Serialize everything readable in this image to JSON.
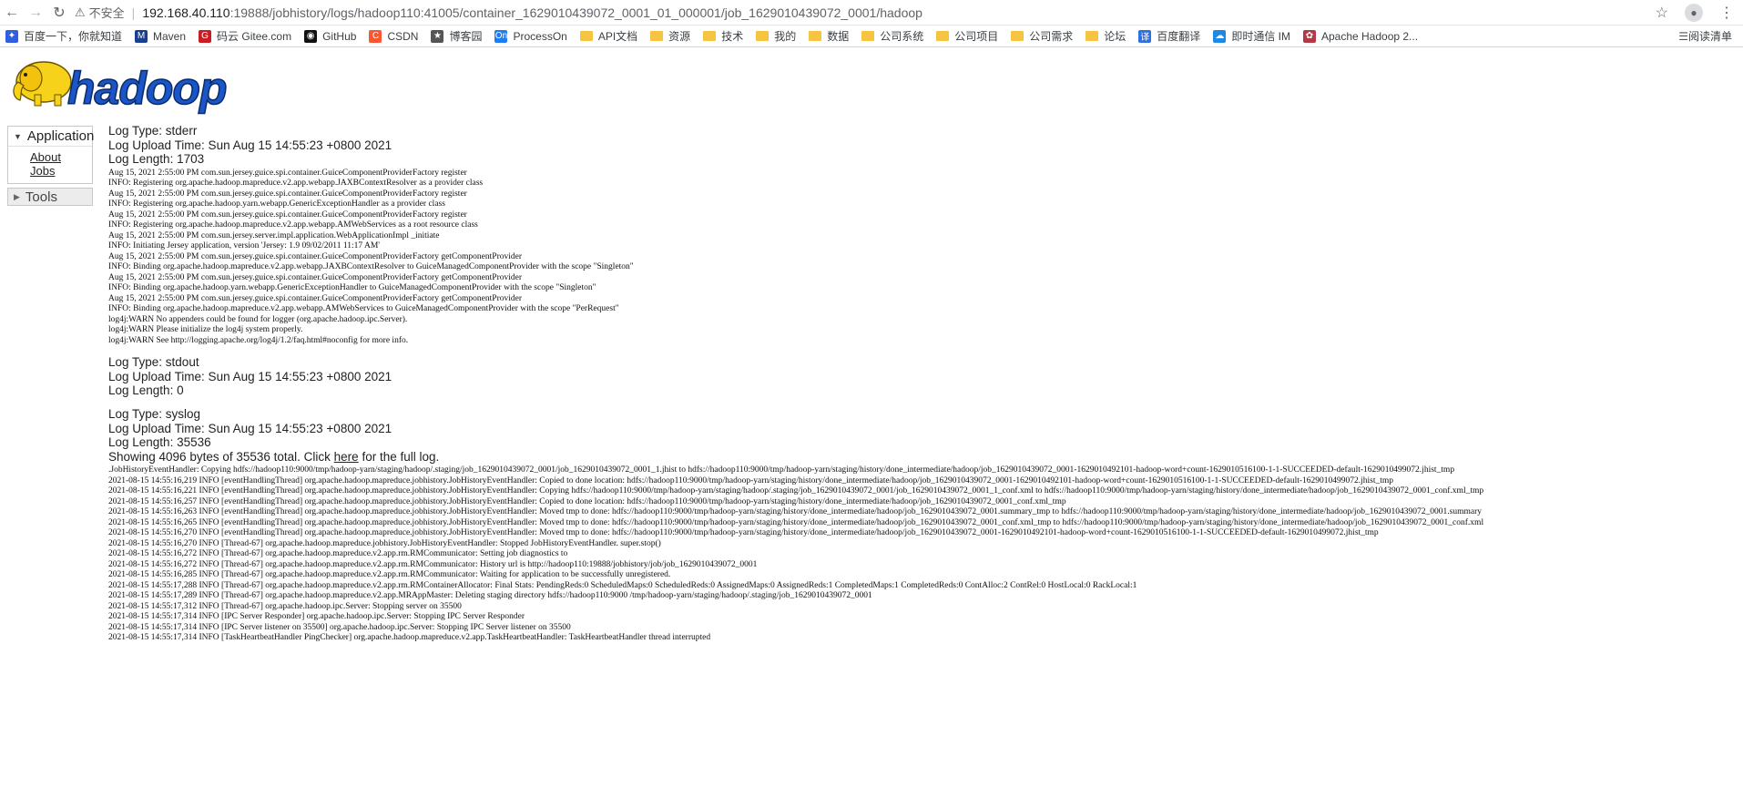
{
  "browser": {
    "insecure_label": "不安全",
    "url_host": "192.168.40.110",
    "url_path": ":19888/jobhistory/logs/hadoop110:41005/container_1629010439072_0001_01_000001/job_1629010439072_0001/hadoop"
  },
  "bookmarks": [
    {
      "label": "百度一下，你就知道",
      "icon": "paw-icon",
      "color": "#2f5fe0"
    },
    {
      "label": "Maven",
      "icon": "maven-icon",
      "color": "#1a3f8f"
    },
    {
      "label": "码云 Gitee.com",
      "icon": "gitee-icon",
      "color": "#c71d23"
    },
    {
      "label": "GitHub",
      "icon": "github-icon",
      "color": "#111111"
    },
    {
      "label": "CSDN",
      "icon": "csdn-icon",
      "color": "#fc5531"
    },
    {
      "label": "博客园",
      "icon": "cnblogs-icon",
      "color": "#555555"
    },
    {
      "label": "ProcessOn",
      "icon": "processon-icon",
      "color": "#1f7cf1"
    },
    {
      "label": "API文档",
      "icon": "folder-icon",
      "color": "#f5c542"
    },
    {
      "label": "资源",
      "icon": "folder-icon",
      "color": "#f5c542"
    },
    {
      "label": "技术",
      "icon": "folder-icon",
      "color": "#f5c542"
    },
    {
      "label": "我的",
      "icon": "folder-icon",
      "color": "#f5c542"
    },
    {
      "label": "数据",
      "icon": "folder-icon",
      "color": "#f5c542"
    },
    {
      "label": "公司系统",
      "icon": "folder-icon",
      "color": "#f5c542"
    },
    {
      "label": "公司项目",
      "icon": "folder-icon",
      "color": "#f5c542"
    },
    {
      "label": "公司需求",
      "icon": "folder-icon",
      "color": "#f5c542"
    },
    {
      "label": "论坛",
      "icon": "folder-icon",
      "color": "#f5c542"
    },
    {
      "label": "百度翻译",
      "icon": "translate-icon",
      "color": "#2f6fe0"
    },
    {
      "label": "即时通信 IM",
      "icon": "cloud-icon",
      "color": "#1e88e5"
    },
    {
      "label": "Apache Hadoop 2...",
      "icon": "feather-icon",
      "color": "#b23a48"
    }
  ],
  "reading_list": "阅读清单",
  "logo": {
    "text": "hadoop"
  },
  "nav": {
    "application": "Application",
    "links": [
      "About",
      "Jobs"
    ],
    "tools": "Tools"
  },
  "stderr": {
    "type": "Log Type: stderr",
    "upload": "Log Upload Time: Sun Aug 15 14:55:23 +0800 2021",
    "length": "Log Length: 1703",
    "lines": "Aug 15, 2021 2:55:00 PM com.sun.jersey.guice.spi.container.GuiceComponentProviderFactory register\nINFO: Registering org.apache.hadoop.mapreduce.v2.app.webapp.JAXBContextResolver as a provider class\nAug 15, 2021 2:55:00 PM com.sun.jersey.guice.spi.container.GuiceComponentProviderFactory register\nINFO: Registering org.apache.hadoop.yarn.webapp.GenericExceptionHandler as a provider class\nAug 15, 2021 2:55:00 PM com.sun.jersey.guice.spi.container.GuiceComponentProviderFactory register\nINFO: Registering org.apache.hadoop.mapreduce.v2.app.webapp.AMWebServices as a root resource class\nAug 15, 2021 2:55:00 PM com.sun.jersey.server.impl.application.WebApplicationImpl _initiate\nINFO: Initiating Jersey application, version 'Jersey: 1.9 09/02/2011 11:17 AM'\nAug 15, 2021 2:55:00 PM com.sun.jersey.guice.spi.container.GuiceComponentProviderFactory getComponentProvider\nINFO: Binding org.apache.hadoop.mapreduce.v2.app.webapp.JAXBContextResolver to GuiceManagedComponentProvider with the scope \"Singleton\"\nAug 15, 2021 2:55:00 PM com.sun.jersey.guice.spi.container.GuiceComponentProviderFactory getComponentProvider\nINFO: Binding org.apache.hadoop.yarn.webapp.GenericExceptionHandler to GuiceManagedComponentProvider with the scope \"Singleton\"\nAug 15, 2021 2:55:00 PM com.sun.jersey.guice.spi.container.GuiceComponentProviderFactory getComponentProvider\nINFO: Binding org.apache.hadoop.mapreduce.v2.app.webapp.AMWebServices to GuiceManagedComponentProvider with the scope \"PerRequest\"\nlog4j:WARN No appenders could be found for logger (org.apache.hadoop.ipc.Server).\nlog4j:WARN Please initialize the log4j system properly.\nlog4j:WARN See http://logging.apache.org/log4j/1.2/faq.html#noconfig for more info."
  },
  "stdout": {
    "type": "Log Type: stdout",
    "upload": "Log Upload Time: Sun Aug 15 14:55:23 +0800 2021",
    "length": "Log Length: 0"
  },
  "syslog": {
    "type": "Log Type: syslog",
    "upload": "Log Upload Time: Sun Aug 15 14:55:23 +0800 2021",
    "length": "Log Length: 35536",
    "showing_prefix": "Showing 4096 bytes of 35536 total. Click ",
    "here": "here",
    "showing_suffix": " for the full log.",
    "lines": ".JobHistoryEventHandler: Copying hdfs://hadoop110:9000/tmp/hadoop-yarn/staging/hadoop/.staging/job_1629010439072_0001/job_1629010439072_0001_1.jhist to hdfs://hadoop110:9000/tmp/hadoop-yarn/staging/history/done_intermediate/hadoop/job_1629010439072_0001-1629010492101-hadoop-word+count-1629010516100-1-1-SUCCEEDED-default-1629010499072.jhist_tmp\n2021-08-15 14:55:16,219 INFO [eventHandlingThread] org.apache.hadoop.mapreduce.jobhistory.JobHistoryEventHandler: Copied to done location: hdfs://hadoop110:9000/tmp/hadoop-yarn/staging/history/done_intermediate/hadoop/job_1629010439072_0001-1629010492101-hadoop-word+count-1629010516100-1-1-SUCCEEDED-default-1629010499072.jhist_tmp\n2021-08-15 14:55:16,221 INFO [eventHandlingThread] org.apache.hadoop.mapreduce.jobhistory.JobHistoryEventHandler: Copying hdfs://hadoop110:9000/tmp/hadoop-yarn/staging/hadoop/.staging/job_1629010439072_0001/job_1629010439072_0001_1_conf.xml to hdfs://hadoop110:9000/tmp/hadoop-yarn/staging/history/done_intermediate/hadoop/job_1629010439072_0001_conf.xml_tmp\n2021-08-15 14:55:16,257 INFO [eventHandlingThread] org.apache.hadoop.mapreduce.jobhistory.JobHistoryEventHandler: Copied to done location: hdfs://hadoop110:9000/tmp/hadoop-yarn/staging/history/done_intermediate/hadoop/job_1629010439072_0001_conf.xml_tmp\n2021-08-15 14:55:16,263 INFO [eventHandlingThread] org.apache.hadoop.mapreduce.jobhistory.JobHistoryEventHandler: Moved tmp to done: hdfs://hadoop110:9000/tmp/hadoop-yarn/staging/history/done_intermediate/hadoop/job_1629010439072_0001.summary_tmp to hdfs://hadoop110:9000/tmp/hadoop-yarn/staging/history/done_intermediate/hadoop/job_1629010439072_0001.summary\n2021-08-15 14:55:16,265 INFO [eventHandlingThread] org.apache.hadoop.mapreduce.jobhistory.JobHistoryEventHandler: Moved tmp to done: hdfs://hadoop110:9000/tmp/hadoop-yarn/staging/history/done_intermediate/hadoop/job_1629010439072_0001_conf.xml_tmp to hdfs://hadoop110:9000/tmp/hadoop-yarn/staging/history/done_intermediate/hadoop/job_1629010439072_0001_conf.xml\n2021-08-15 14:55:16,270 INFO [eventHandlingThread] org.apache.hadoop.mapreduce.jobhistory.JobHistoryEventHandler: Moved tmp to done: hdfs://hadoop110:9000/tmp/hadoop-yarn/staging/history/done_intermediate/hadoop/job_1629010439072_0001-1629010492101-hadoop-word+count-1629010516100-1-1-SUCCEEDED-default-1629010499072.jhist_tmp\n2021-08-15 14:55:16,270 INFO [Thread-67] org.apache.hadoop.mapreduce.jobhistory.JobHistoryEventHandler: Stopped JobHistoryEventHandler. super.stop()\n2021-08-15 14:55:16,272 INFO [Thread-67] org.apache.hadoop.mapreduce.v2.app.rm.RMCommunicator: Setting job diagnostics to\n2021-08-15 14:55:16,272 INFO [Thread-67] org.apache.hadoop.mapreduce.v2.app.rm.RMCommunicator: History url is http://hadoop110:19888/jobhistory/job/job_1629010439072_0001\n2021-08-15 14:55:16,285 INFO [Thread-67] org.apache.hadoop.mapreduce.v2.app.rm.RMCommunicator: Waiting for application to be successfully unregistered.\n2021-08-15 14:55:17,288 INFO [Thread-67] org.apache.hadoop.mapreduce.v2.app.rm.RMContainerAllocator: Final Stats: PendingReds:0 ScheduledMaps:0 ScheduledReds:0 AssignedMaps:0 AssignedReds:1 CompletedMaps:1 CompletedReds:0 ContAlloc:2 ContRel:0 HostLocal:0 RackLocal:1\n2021-08-15 14:55:17,289 INFO [Thread-67] org.apache.hadoop.mapreduce.v2.app.MRAppMaster: Deleting staging directory hdfs://hadoop110:9000 /tmp/hadoop-yarn/staging/hadoop/.staging/job_1629010439072_0001\n2021-08-15 14:55:17,312 INFO [Thread-67] org.apache.hadoop.ipc.Server: Stopping server on 35500\n2021-08-15 14:55:17,314 INFO [IPC Server Responder] org.apache.hadoop.ipc.Server: Stopping IPC Server Responder\n2021-08-15 14:55:17,314 INFO [IPC Server listener on 35500] org.apache.hadoop.ipc.Server: Stopping IPC Server listener on 35500\n2021-08-15 14:55:17,314 INFO [TaskHeartbeatHandler PingChecker] org.apache.hadoop.mapreduce.v2.app.TaskHeartbeatHandler: TaskHeartbeatHandler thread interrupted"
  }
}
